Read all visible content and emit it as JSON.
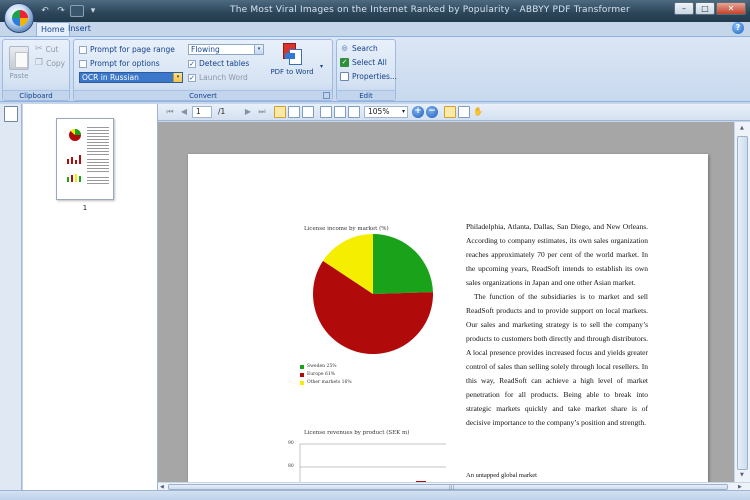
{
  "window": {
    "title": "The Most Viral Images on the Internet Ranked by Popularity - ABBYY PDF Transformer"
  },
  "quick_access": {
    "undo": "↶",
    "redo": "↷",
    "more": "▾"
  },
  "tabs": [
    {
      "label": "Home"
    },
    {
      "label": "Insert"
    }
  ],
  "help_label": "?",
  "ribbon": {
    "clipboard": {
      "label": "Clipboard",
      "paste": "Paste",
      "cut": "Cut",
      "copy": "Copy"
    },
    "convert": {
      "label": "Convert",
      "prompt_page_range": "Prompt for page range",
      "prompt_options": "Prompt for options",
      "ocr_language": "OCR in Russian",
      "layout_mode": "Flowing",
      "detect_tables": "Detect tables",
      "launch_word": "Launch Word",
      "pdf_to_word": "PDF to Word",
      "dropdown": "▾",
      "checked_mark": "✓"
    },
    "edit": {
      "label": "Edit",
      "search": "Search",
      "select_all": "Select All",
      "properties": "Properties..."
    }
  },
  "viewer": {
    "current_page": "1",
    "page_total": "/1",
    "zoom": "105%",
    "zoom_in": "+",
    "zoom_out": "−"
  },
  "thumbnails": [
    {
      "label": "1"
    }
  ],
  "document": {
    "chart1": {
      "title": "License income by market (%)",
      "legend": [
        {
          "label": "Sweden 25%",
          "color": "#1aa31a"
        },
        {
          "label": "Europe 61%",
          "color": "#b10a0a"
        },
        {
          "label": "Other markets 16%",
          "color": "#f5ee00"
        }
      ]
    },
    "chart2": {
      "title": "License revenues by product (SEK m)",
      "ticks": [
        "90",
        "80"
      ]
    },
    "paragraphs": [
      "Philadelphia, Atlanta, Dallas, San Diego, and New Orleans. According to company estimates, its own sales organization reaches approximately 70 per cent of the world market. In the upcoming years, ReadSoft intends to establish its own sales organizations in Japan and one other Asian market.",
      "The function of the subsidiaries is to market and sell ReadSoft products and to provide support on local markets. Our sales and marketing strategy is to sell the company’s products to customers both directly and through distributors. A local presence provides increased focus and yields greater control of sales than selling solely through local resellers. In this way, ReadSoft can achieve a high level of market penetration for all products. Being able to break into strategic markets quickly and take market share is of decisive importance to the company’s position and strength."
    ],
    "subheading": "An untapped global market"
  },
  "chart_data": {
    "type": "pie",
    "title": "License income by market (%)",
    "categories": [
      "Sweden",
      "Europe",
      "Other markets"
    ],
    "values": [
      25,
      61,
      16
    ],
    "colors": [
      "#1aa31a",
      "#b10a0a",
      "#f5ee00"
    ],
    "legend": "bottom-left"
  }
}
